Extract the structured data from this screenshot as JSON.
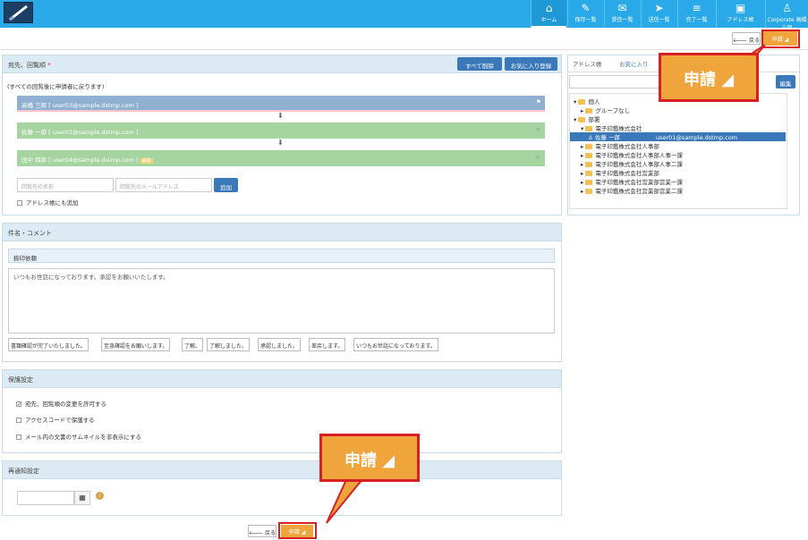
{
  "header": {
    "nav": [
      {
        "label": "ホーム",
        "icon": "home-icon",
        "glyph": "⌂"
      },
      {
        "label": "保存一覧",
        "icon": "edit-icon",
        "glyph": "✎"
      },
      {
        "label": "受信一覧",
        "icon": "inbox-icon",
        "glyph": "✉"
      },
      {
        "label": "送信一覧",
        "icon": "send-icon",
        "glyph": "➤"
      },
      {
        "label": "完了一覧",
        "icon": "list-icon",
        "glyph": "≡"
      },
      {
        "label": "アドレス帳",
        "icon": "addressbook-icon",
        "glyph": "▣"
      },
      {
        "label": "Corporate 高橋 三郎",
        "icon": "user-icon",
        "glyph": "♙"
      }
    ]
  },
  "toolbar": {
    "back_label": "戻る",
    "apply_label": "申請"
  },
  "recipients": {
    "title": "宛先、回覧順",
    "required_mark": "*",
    "delete_all": "すべて削除",
    "register_favorite": "お気に入り登録",
    "note": "(すべての回覧後に申請者に戻ります)",
    "flow": [
      {
        "text": "高橋 三郎 [ user03@sample.dstmp.com ]"
      },
      {
        "text": "佐藤 一郎 [ user01@sample.dstmp.com ]"
      },
      {
        "text": "田中 四郎 [ user04@sample.dstmp.com ]",
        "badge": "承認"
      }
    ],
    "name_placeholder": "回覧先の名前",
    "email_placeholder": "回覧先のメールアドレス",
    "add_label": "追加",
    "add_to_addressbook": "アドレス帳にも追加"
  },
  "address_panel": {
    "tabs": [
      "アドレス帳",
      "お気に入り"
    ],
    "edit_label": "編集",
    "tree": [
      {
        "label": "個人",
        "level": 0,
        "expanded": true
      },
      {
        "label": "グループなし",
        "level": 1
      },
      {
        "label": "部署",
        "level": 0,
        "expanded": true
      },
      {
        "label": "電子印鑑株式会社",
        "level": 1,
        "expanded": true
      },
      {
        "label": "佐藤 一郎",
        "email": "user01@sample.dstmp.com",
        "level": 2,
        "selected": true
      },
      {
        "label": "電子印鑑株式会社人事部",
        "level": 1
      },
      {
        "label": "電子印鑑株式会社人事部人事一課",
        "level": 1
      },
      {
        "label": "電子印鑑株式会社人事部人事二課",
        "level": 1
      },
      {
        "label": "電子印鑑株式会社営業部",
        "level": 1
      },
      {
        "label": "電子印鑑株式会社営業部営業一課",
        "level": 1
      },
      {
        "label": "電子印鑑株式会社営業部営業二課",
        "level": 1
      }
    ]
  },
  "subject": {
    "title": "件名・コメント",
    "subject_value": "捺印依頼",
    "comment_value": "いつもお世話になっております。承認をお願いいたします。",
    "templates": [
      "書類確認が完了いたしました。",
      "至急確認をお願いします。",
      "了解。",
      "了解しました。",
      "承認しました。",
      "差戻します。",
      "いつもお世話になっております。"
    ]
  },
  "protection": {
    "title": "保護設定",
    "options": [
      {
        "label": "宛先、回覧順の変更を許可する",
        "checked": true
      },
      {
        "label": "アクセスコードで保護する",
        "checked": false
      },
      {
        "label": "メール内の文書のサムネイルを非表示にする",
        "checked": false
      }
    ]
  },
  "reminder": {
    "title": "再通知設定"
  },
  "callouts": {
    "top": "申請",
    "bottom": "申請"
  },
  "colors": {
    "header": "#29a9e8",
    "accent": "#f0a43c",
    "flow_first": "#8fb0d0",
    "flow_rest": "#a6d4a0",
    "highlight": "#d81f26"
  }
}
